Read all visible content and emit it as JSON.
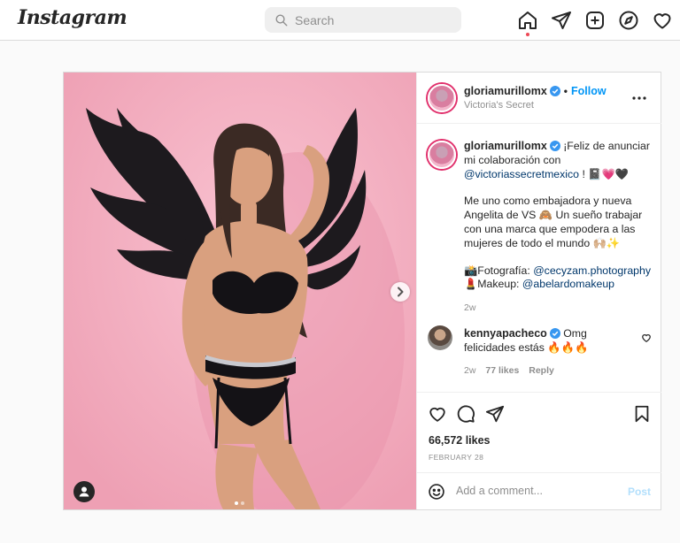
{
  "app": {
    "logo": "Instagram"
  },
  "search": {
    "placeholder": "Search"
  },
  "nav": {
    "icons": [
      "home-icon",
      "direct-icon",
      "new-post-icon",
      "explore-icon",
      "activity-icon"
    ]
  },
  "post": {
    "author": "gloriamurillomx",
    "follow_label": "Follow",
    "location": "Victoria's Secret",
    "caption": {
      "line1_text": "¡Feliz de anunciar mi colaboración con",
      "mention": "@victoriassecretmexico",
      "line1_tail": "! 📓💗🖤",
      "paragraph2": "Me uno como embajadora y nueva Angelita de VS 🙈 Un sueño trabajar con una marca que empodera a las mujeres de todo el mundo 🙌🏼✨",
      "photo_prefix": "📸Fotografía: ",
      "photo_mention": "@cecyzam.photography",
      "makeup_prefix": "💄Makeup: ",
      "makeup_mention": "@abelardomakeup",
      "age": "2w"
    },
    "comment": {
      "user": "kennyapacheco",
      "text": "Omg felicidades estás 🔥🔥🔥",
      "age": "2w",
      "likes": "77 likes",
      "reply": "Reply"
    },
    "likes": "66,572 likes",
    "date": "FEBRUARY 28",
    "add_comment_placeholder": "Add a comment...",
    "post_button": "Post"
  },
  "colors": {
    "accent": "#0095f6",
    "verified": "#3897f0",
    "post_disabled": "#b2dffc",
    "notification": "#ed4956",
    "photo_bg": "#f4a6b9"
  }
}
